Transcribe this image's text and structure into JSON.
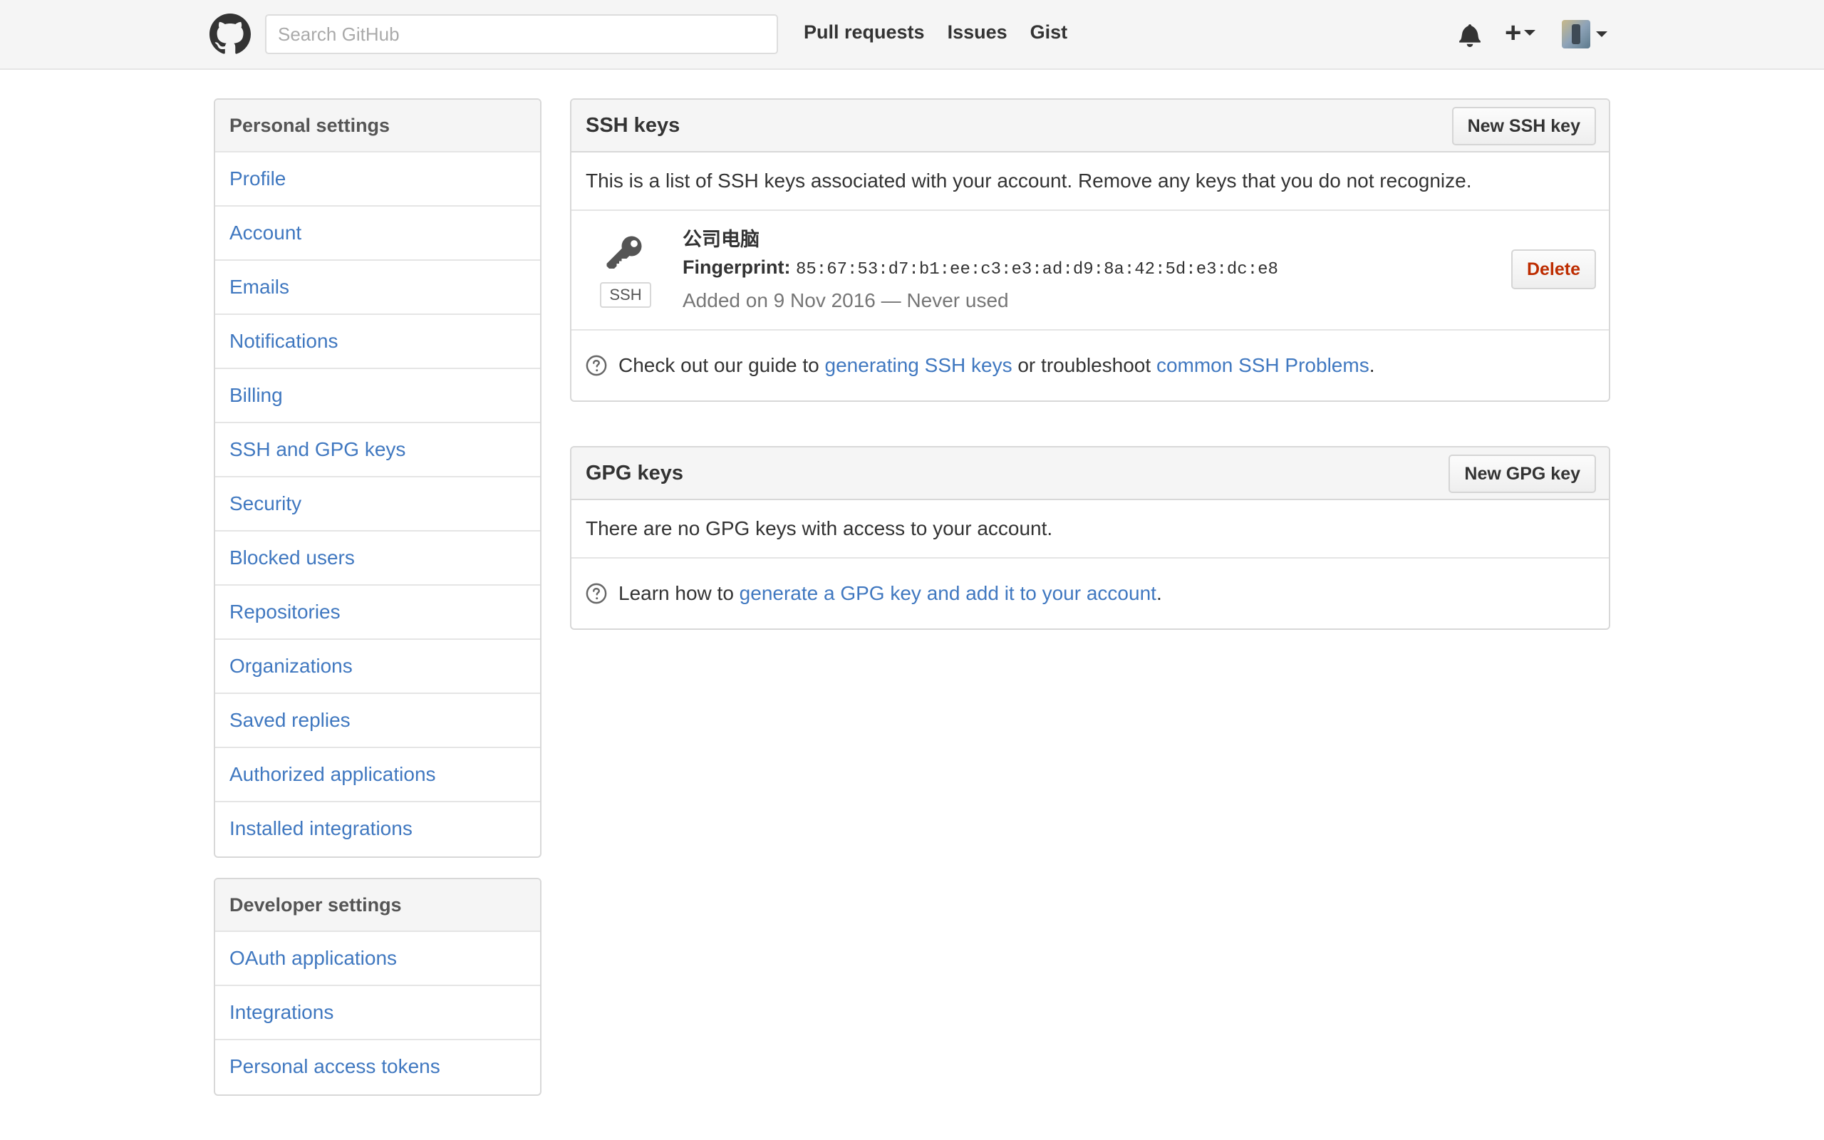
{
  "header": {
    "search_placeholder": "Search GitHub",
    "nav": [
      "Pull requests",
      "Issues",
      "Gist"
    ],
    "icons": [
      "github-logo-icon",
      "bell-icon",
      "plus-icon",
      "avatar"
    ]
  },
  "sidebar": {
    "personal": {
      "heading": "Personal settings",
      "items": [
        "Profile",
        "Account",
        "Emails",
        "Notifications",
        "Billing",
        "SSH and GPG keys",
        "Security",
        "Blocked users",
        "Repositories",
        "Organizations",
        "Saved replies",
        "Authorized applications",
        "Installed integrations"
      ]
    },
    "developer": {
      "heading": "Developer settings",
      "items": [
        "OAuth applications",
        "Integrations",
        "Personal access tokens"
      ]
    }
  },
  "ssh": {
    "title": "SSH keys",
    "new_button": "New SSH key",
    "description": "This is a list of SSH keys associated with your account. Remove any keys that you do not recognize.",
    "key": {
      "badge": "SSH",
      "name": "公司电脑",
      "fingerprint_label": "Fingerprint:",
      "fingerprint": "85:67:53:d7:b1:ee:c3:e3:ad:d9:8a:42:5d:e3:dc:e8",
      "added": "Added on 9 Nov 2016 — Never used",
      "delete_button": "Delete"
    },
    "help": {
      "prefix": "Check out our guide to",
      "link1": "generating SSH keys",
      "middle": "or troubleshoot",
      "link2": "common SSH Problems",
      "suffix": "."
    }
  },
  "gpg": {
    "title": "GPG keys",
    "new_button": "New GPG key",
    "description": "There are no GPG keys with access to your account.",
    "help": {
      "prefix": "Learn how to",
      "link": "generate a GPG key and add it to your account",
      "suffix": "."
    }
  },
  "colors": {
    "link": "#4078c0",
    "danger": "#bd2c00",
    "header_bg": "#f5f5f5",
    "border": "#d8d8d8"
  }
}
